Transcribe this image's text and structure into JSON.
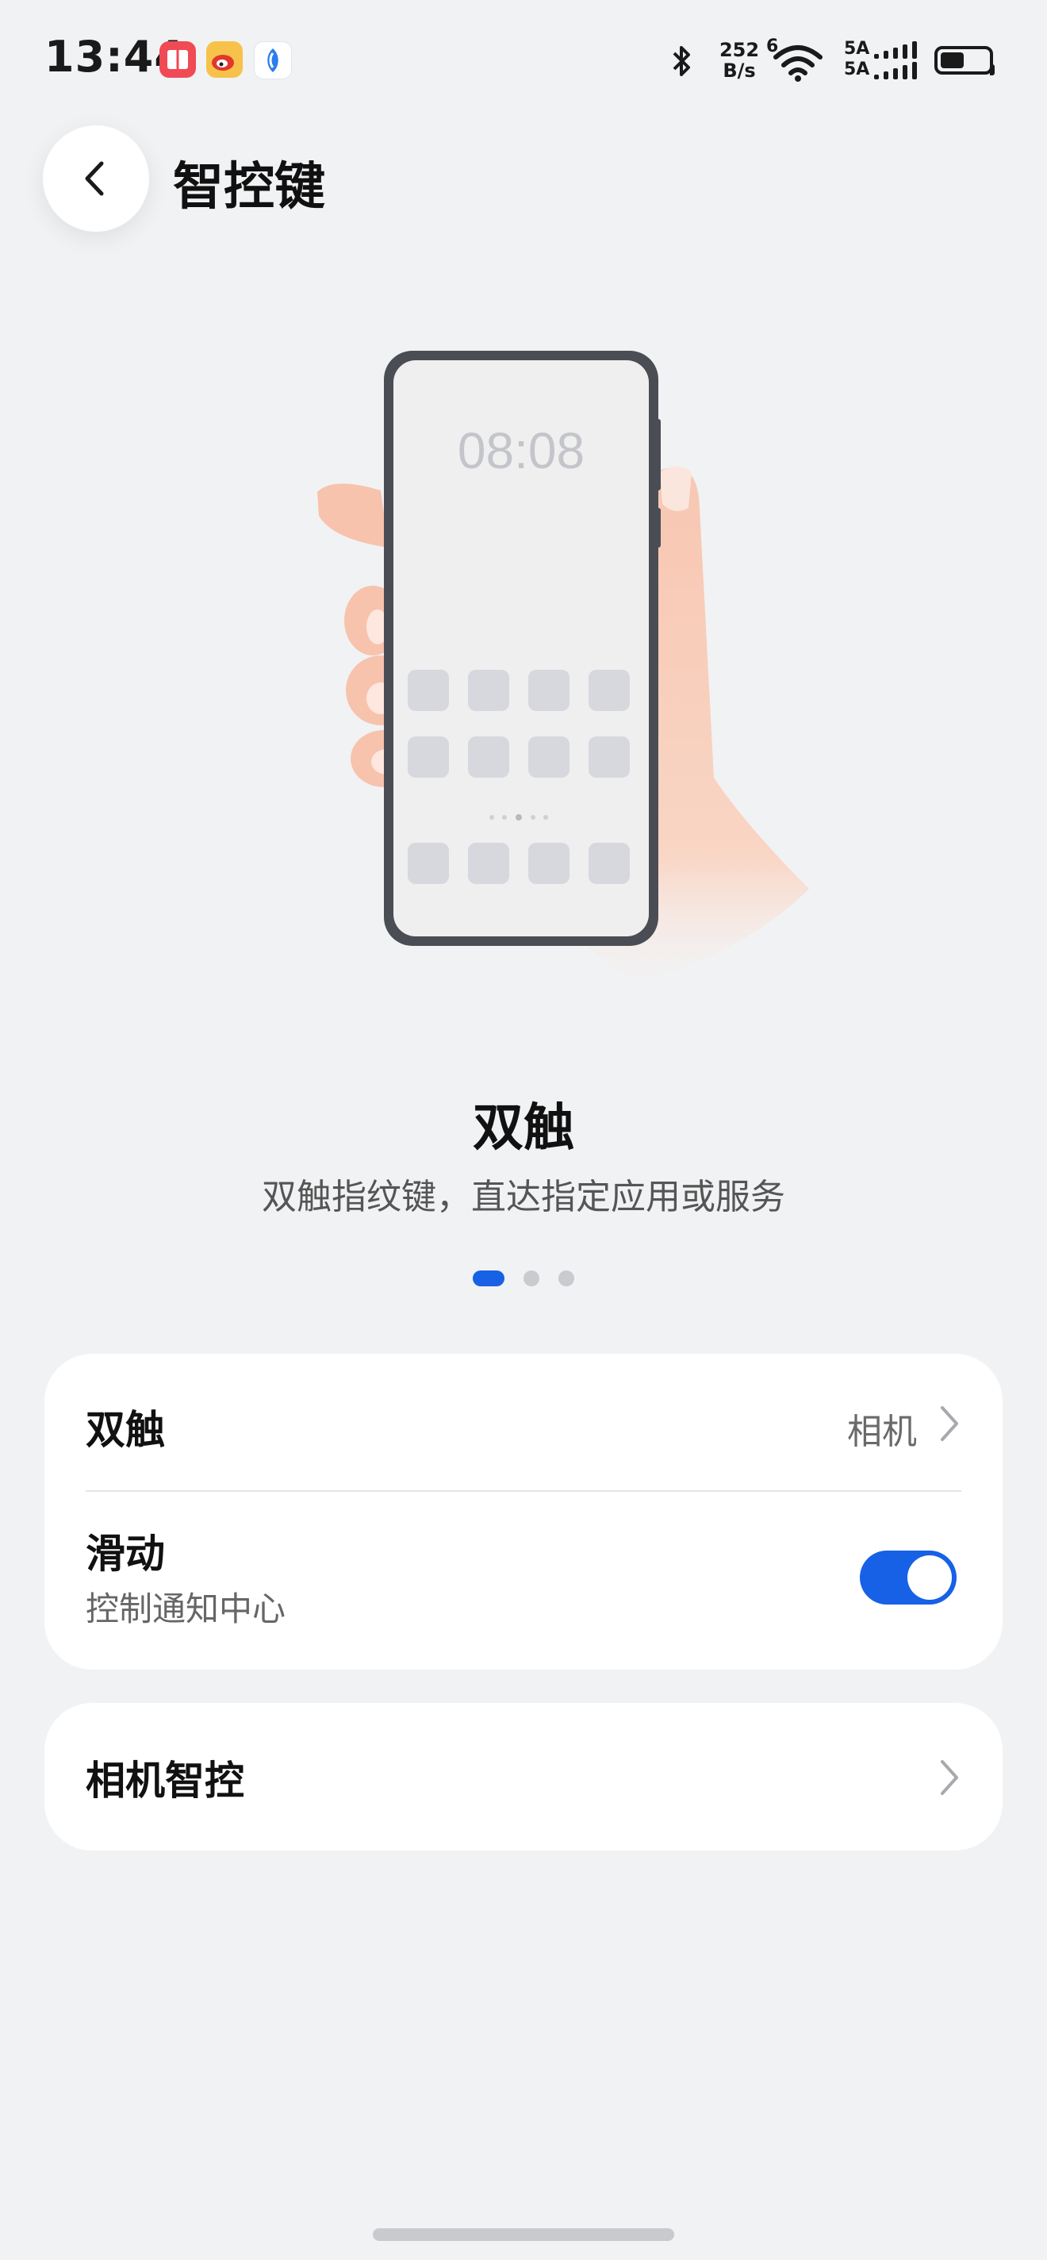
{
  "status_bar": {
    "time": "13:44",
    "net_speed_value": "252",
    "net_speed_unit": "B/s",
    "wifi_badge": "6",
    "signal_1": "5A",
    "signal_2": "5A",
    "battery_level": 0.5,
    "app_icons": [
      "reading-app-icon",
      "weibo-icon",
      "blue-app-icon"
    ]
  },
  "header": {
    "title": "智控键",
    "back_icon": "chevron-left-icon"
  },
  "illustration": {
    "phone_clock": "08:08"
  },
  "feature": {
    "title": "双触",
    "description": "双触指纹键，直达指定应用或服务",
    "pages": 3,
    "active_page": 1
  },
  "settings": {
    "double_touch": {
      "label": "双触",
      "value": "相机"
    },
    "swipe": {
      "label": "滑动",
      "sublabel": "控制通知中心",
      "enabled": true
    },
    "camera_control": {
      "label": "相机智控"
    }
  },
  "colors": {
    "background": "#f1f2f4",
    "accent": "#1761e6",
    "card": "#ffffff"
  }
}
